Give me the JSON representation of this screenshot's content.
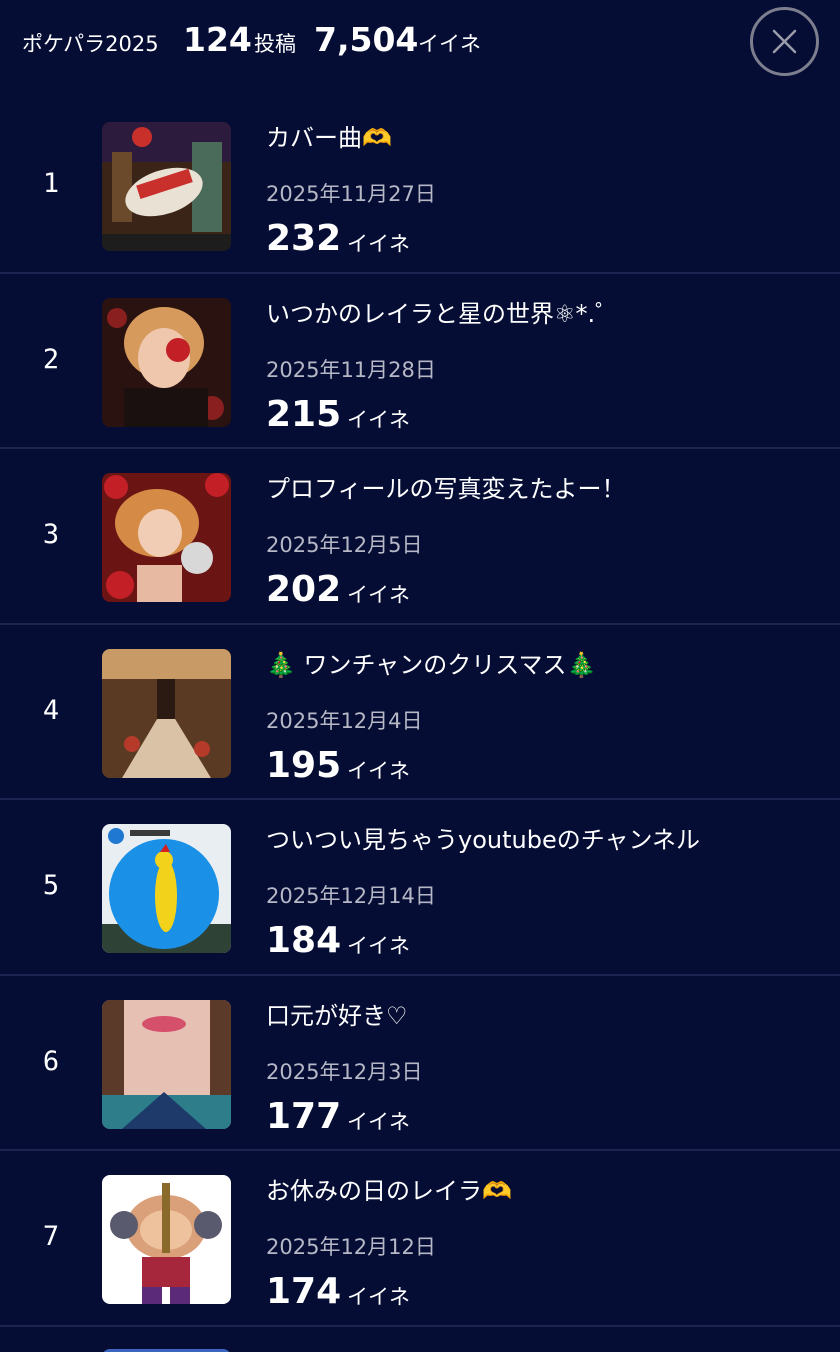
{
  "header": {
    "label": "ポケパラ2025",
    "posts_value": "124",
    "posts_unit": "投稿",
    "likes_value": "7,504",
    "likes_unit": "イイネ",
    "close_icon": "close-icon"
  },
  "colors": {
    "background": "#050d35",
    "divider": "#1b2550",
    "date_text": "#b6b8c6"
  },
  "items": [
    {
      "rank": "1",
      "title": "カバー曲🫶",
      "date": "2025年11月27日",
      "likes": "232",
      "unit": "イイネ"
    },
    {
      "rank": "2",
      "title": "いつかのレイラと星の世界⚛︎*.゜",
      "date": "2025年11月28日",
      "likes": "215",
      "unit": "イイネ"
    },
    {
      "rank": "3",
      "title": "プロフィールの写真変えたよー！",
      "date": "2025年12月5日",
      "likes": "202",
      "unit": "イイネ"
    },
    {
      "rank": "4",
      "title": "🎄 ワンチャンのクリスマス🎄",
      "date": "2025年12月4日",
      "likes": "195",
      "unit": "イイネ"
    },
    {
      "rank": "5",
      "title": "ついつい見ちゃうyoutubeのチャンネル",
      "date": "2025年12月14日",
      "likes": "184",
      "unit": "イイネ"
    },
    {
      "rank": "6",
      "title": "口元が好き♡",
      "date": "2025年12月3日",
      "likes": "177",
      "unit": "イイネ"
    },
    {
      "rank": "7",
      "title": "お休みの日のレイラ🫶",
      "date": "2025年12月12日",
      "likes": "174",
      "unit": "イイネ"
    }
  ]
}
